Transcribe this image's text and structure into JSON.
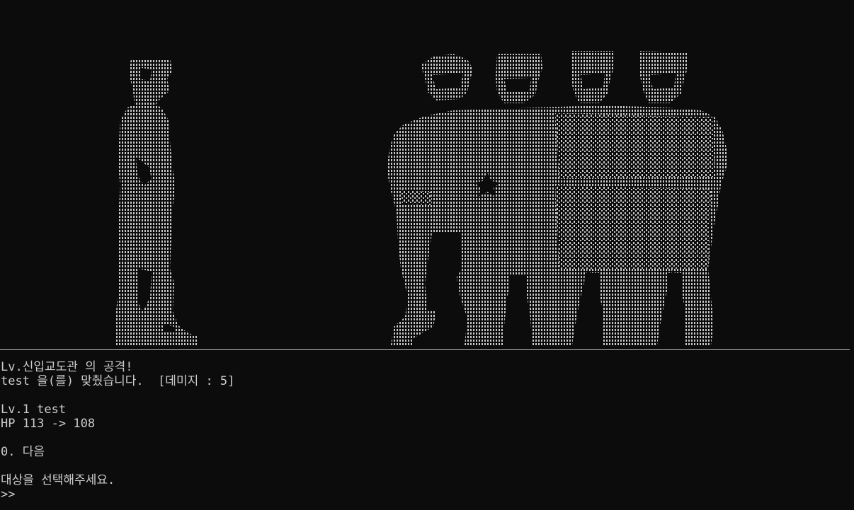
{
  "log": {
    "attack_line": "Lv.신입교도관 의 공격!",
    "hit_line": "test 을(를) 맞췄습니다.  [데미지 : 5]",
    "target_name_line": "Lv.1 test",
    "hp_line": "HP 113 -> 108",
    "next_option": "0. 다음",
    "select_prompt": "대상을 선택해주세요.",
    "input_prompt": ">>"
  },
  "art": {
    "player_figure": "ascii-art-prisoner",
    "enemy_group": "ascii-art-guard-group",
    "dot_color": "#c8c8c8"
  },
  "colors": {
    "background": "#0c0c0c",
    "text": "#cccccc"
  }
}
